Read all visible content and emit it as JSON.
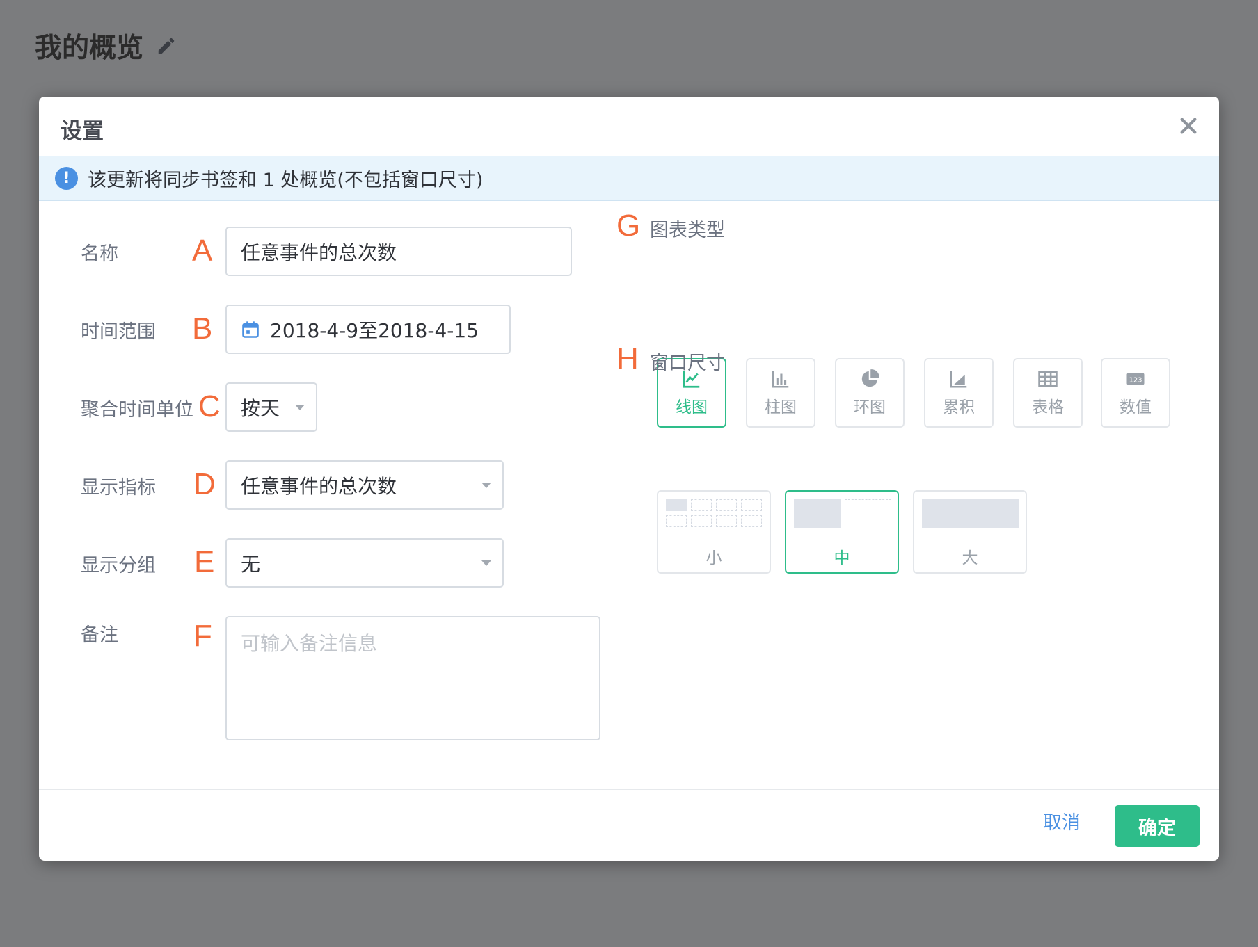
{
  "page": {
    "title": "我的概览",
    "edit_icon": "pencil-icon"
  },
  "modal": {
    "title": "设置",
    "notice": "该更新将同步书签和 1 处概览(不包括窗口尺寸)",
    "form": {
      "name": {
        "label": "名称",
        "marker": "A",
        "value": "任意事件的总次数"
      },
      "time_range": {
        "label": "时间范围",
        "marker": "B",
        "value": "2018-4-9至2018-4-15"
      },
      "agg_unit": {
        "label": "聚合时间单位",
        "marker": "C",
        "value": "按天"
      },
      "metric": {
        "label": "显示指标",
        "marker": "D",
        "value": "任意事件的总次数"
      },
      "group": {
        "label": "显示分组",
        "marker": "E",
        "value": "无"
      },
      "note": {
        "label": "备注",
        "marker": "F",
        "placeholder": "可输入备注信息"
      }
    },
    "chart_type": {
      "label": "图表类型",
      "marker": "G",
      "selected": "线图",
      "options": [
        {
          "label": "线图",
          "icon": "line-chart-icon"
        },
        {
          "label": "柱图",
          "icon": "bar-chart-icon"
        },
        {
          "label": "环图",
          "icon": "pie-chart-icon"
        },
        {
          "label": "累积",
          "icon": "area-chart-icon"
        },
        {
          "label": "表格",
          "icon": "table-icon"
        },
        {
          "label": "数值",
          "icon": "number-icon"
        }
      ]
    },
    "window_size": {
      "label": "窗口尺寸",
      "marker": "H",
      "selected": "中",
      "options": [
        {
          "label": "小"
        },
        {
          "label": "中"
        },
        {
          "label": "大"
        }
      ]
    },
    "footer": {
      "cancel": "取消",
      "ok": "确定"
    }
  },
  "colors": {
    "accent": "#2ebd8a",
    "link": "#4a90e2",
    "marker": "#f26b3a",
    "notice_bg": "#e8f4fc"
  }
}
